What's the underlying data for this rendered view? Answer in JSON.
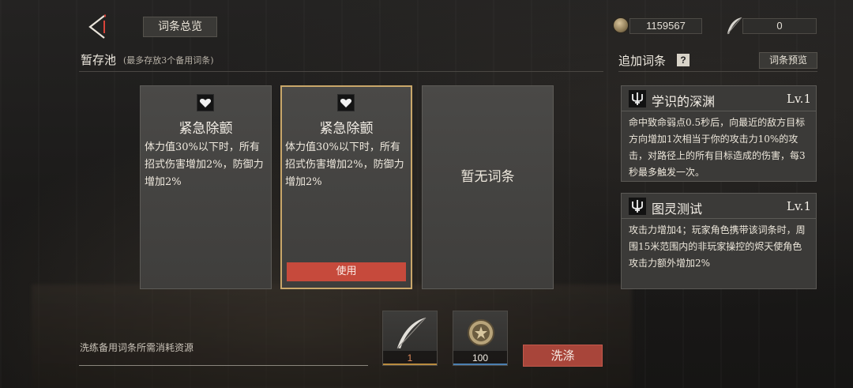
{
  "topbar": {
    "overview_label": "词条总览",
    "coin_value": "1159567",
    "feather_value": "0",
    "icons": {
      "back": "back-arrow-icon",
      "coin": "coin-icon",
      "feather": "feather-icon"
    }
  },
  "pool": {
    "title": "暂存池",
    "subtitle": "(最多存放3个备用词条)",
    "cards": [
      {
        "name": "紧急除颤",
        "desc": "体力值30%以下时，所有招式伤害增加2%，防御力增加2%"
      },
      {
        "name": "紧急除颤",
        "desc": "体力值30%以下时，所有招式伤害增加2%，防御力增加2%",
        "use_label": "使用"
      },
      {
        "empty_label": "暂无词条"
      }
    ]
  },
  "added": {
    "title": "追加词条",
    "help_label": "?",
    "preview_label": "词条预览",
    "affixes": [
      {
        "name": "学识的深渊",
        "level": "Lv.1",
        "desc": "命中致命弱点0.5秒后，向最近的敌方目标方向增加1次相当于你的攻击力10%的攻击，对路径上的所有目标造成的伤害，每3秒最多触发一次。"
      },
      {
        "name": "图灵测试",
        "level": "Lv.1",
        "desc": "攻击力增加4；玩家角色携带该词条时，周围15米范围内的非玩家操控的烬天使角色攻击力额外增加2%"
      }
    ]
  },
  "bottom": {
    "cost_label": "洗练备用词条所需消耗资源",
    "feather_cost": "1",
    "coin_cost": "100",
    "wash_label": "洗涤"
  },
  "colors": {
    "accent_red": "#c64a3c",
    "selected_border": "#c9a76a",
    "panel_bg": "#3b3a38"
  }
}
